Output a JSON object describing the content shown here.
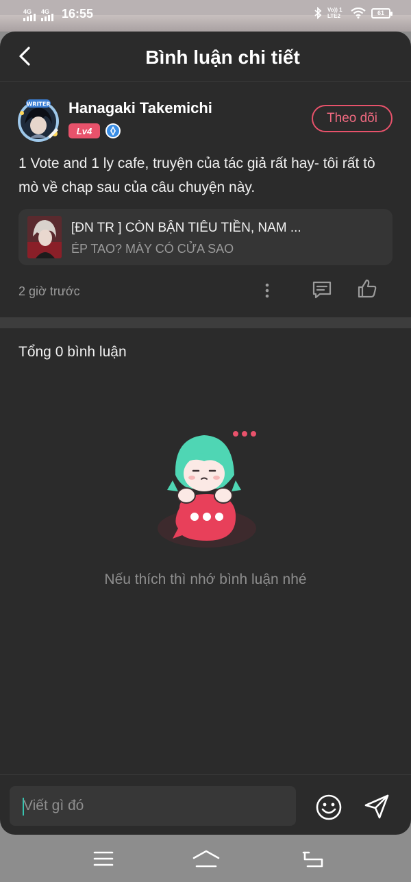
{
  "status_bar": {
    "network1": "4G",
    "network2": "4G",
    "time": "16:55",
    "volte": "Vo)) 1 LTE2",
    "battery": "61"
  },
  "header": {
    "title": "Bình luận chi tiết"
  },
  "post": {
    "username": "Hanagaki Takemichi",
    "level": "Lv4",
    "follow_label": "Theo dõi",
    "content": "1 Vote and 1 ly cafe, truyện của tác giả rất hay- tôi rất tò mò về chap sau của câu chuyện này.",
    "book": {
      "title": "[ĐN TR ] CÒN BẬN TIÊU TIỀN, NAM ...",
      "subtitle": "ÉP TAO? MÀY CÓ CỬA SAO"
    },
    "time_ago": "2 giờ trước"
  },
  "comments": {
    "total_label": "Tổng 0 bình luận",
    "empty_text": "Nếu thích thì nhớ bình luận nhé"
  },
  "input": {
    "placeholder": "Viết gì đó"
  },
  "colors": {
    "accent": "#e8526b",
    "panel_bg": "#2b2b2b",
    "caret": "#37c4b0"
  }
}
